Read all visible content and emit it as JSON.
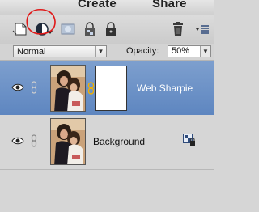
{
  "top_tabs": {
    "create": "Create",
    "share": "Share"
  },
  "toolbar": {
    "icons": [
      "new-layer-icon",
      "adjustment-layer-icon",
      "mask-icon",
      "lock-transparent-icon",
      "lock-all-icon",
      "trash-icon",
      "panel-menu-icon"
    ]
  },
  "controls": {
    "blend_mode": "Normal",
    "opacity_label": "Opacity:",
    "opacity_value": "50%"
  },
  "layers": [
    {
      "name": "Web Sharpie",
      "selected": true
    },
    {
      "name": "Background",
      "selected": false
    }
  ],
  "annotation_color": "#e01818"
}
